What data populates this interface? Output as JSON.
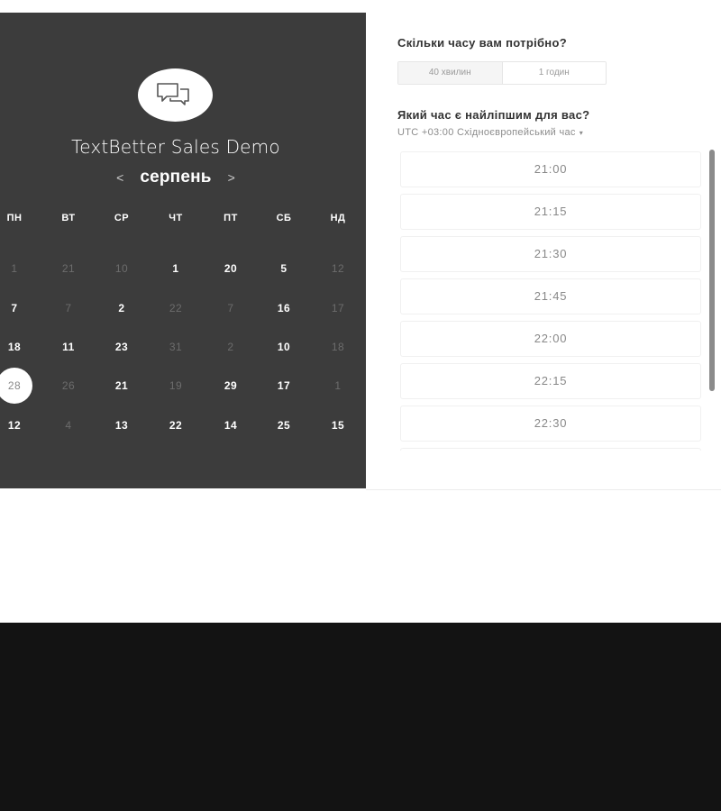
{
  "event": {
    "title": "TextBetter Sales Demo",
    "avatar_icon": "chat-bubbles-icon"
  },
  "calendar": {
    "month": "серпень",
    "prev_icon": "chevron-left-icon",
    "next_icon": "chevron-right-icon",
    "weekdays": [
      "ПН",
      "ВТ",
      "СР",
      "ЧТ",
      "ПТ",
      "СБ",
      "НД"
    ],
    "weeks": [
      [
        {
          "d": "1",
          "s": "inactive"
        },
        {
          "d": "21",
          "s": "inactive"
        },
        {
          "d": "10",
          "s": "inactive"
        },
        {
          "d": "1",
          "s": "active"
        },
        {
          "d": "20",
          "s": "active"
        },
        {
          "d": "5",
          "s": "active"
        },
        {
          "d": "12",
          "s": "inactive"
        }
      ],
      [
        {
          "d": "7",
          "s": "active"
        },
        {
          "d": "7",
          "s": "inactive"
        },
        {
          "d": "2",
          "s": "active"
        },
        {
          "d": "22",
          "s": "inactive"
        },
        {
          "d": "7",
          "s": "inactive"
        },
        {
          "d": "16",
          "s": "active"
        },
        {
          "d": "17",
          "s": "inactive"
        }
      ],
      [
        {
          "d": "18",
          "s": "active"
        },
        {
          "d": "11",
          "s": "active"
        },
        {
          "d": "23",
          "s": "active"
        },
        {
          "d": "31",
          "s": "inactive"
        },
        {
          "d": "2",
          "s": "inactive"
        },
        {
          "d": "10",
          "s": "active"
        },
        {
          "d": "18",
          "s": "inactive"
        }
      ],
      [
        {
          "d": "28",
          "s": "selected"
        },
        {
          "d": "26",
          "s": "inactive"
        },
        {
          "d": "21",
          "s": "active"
        },
        {
          "d": "19",
          "s": "inactive"
        },
        {
          "d": "29",
          "s": "active"
        },
        {
          "d": "17",
          "s": "active"
        },
        {
          "d": "1",
          "s": "inactive"
        }
      ],
      [
        {
          "d": "12",
          "s": "active"
        },
        {
          "d": "4",
          "s": "inactive"
        },
        {
          "d": "13",
          "s": "active"
        },
        {
          "d": "22",
          "s": "active"
        },
        {
          "d": "14",
          "s": "active"
        },
        {
          "d": "25",
          "s": "active"
        },
        {
          "d": "15",
          "s": "active"
        }
      ]
    ]
  },
  "booking": {
    "duration_question": "Скільки часу вам потрібно?",
    "durations": [
      {
        "label": "40 хвилин",
        "selected": true
      },
      {
        "label": "1 годин",
        "selected": false
      }
    ],
    "time_question": "Який час є найліпшим для вас?",
    "timezone": "UTC +03:00 Східноєвропейський час",
    "timezone_caret": "▾",
    "slots": [
      "21:00",
      "21:15",
      "21:30",
      "21:45",
      "22:00",
      "22:15",
      "22:30",
      ""
    ]
  },
  "colors": {
    "panel_bg": "#3c3c3c",
    "footer_bg": "#131313",
    "accent": "#ffffff"
  }
}
